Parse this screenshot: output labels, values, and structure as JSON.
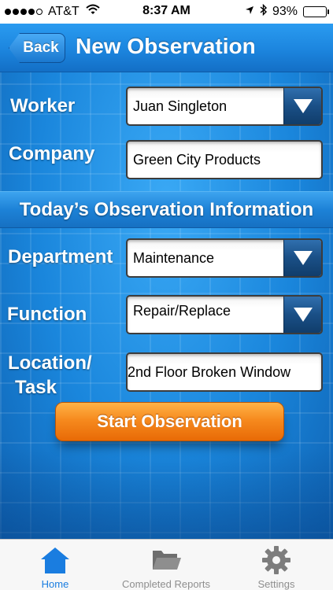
{
  "status_bar": {
    "carrier": "AT&T",
    "time": "8:37 AM",
    "battery": "93%",
    "signal_dots_filled": 4,
    "battery_level": 0.93
  },
  "nav": {
    "back_label": "Back",
    "title": "New Observation"
  },
  "form": {
    "worker_label": "Worker",
    "worker_value": "Juan Singleton",
    "company_label": "Company",
    "company_value": "Green City Products",
    "section_title": "Today’s Observation Information",
    "department_label": "Department",
    "department_value": "Maintenance",
    "function_label": "Function",
    "function_value": "Repair/Replace",
    "location_label_line1": "Location/",
    "location_label_line2": "Task",
    "location_value": "2nd Floor Broken Window"
  },
  "start_button_label": "Start Observation",
  "tabs": [
    {
      "label": "Home",
      "icon": "home-icon",
      "active": true
    },
    {
      "label": "Completed Reports",
      "icon": "folder-icon",
      "active": false
    },
    {
      "label": "Settings",
      "icon": "gear-icon",
      "active": false
    }
  ],
  "colors": {
    "accent_blue": "#1a7de0",
    "button_orange": "#f68a1e",
    "background_blue": "#1c8ee6"
  }
}
